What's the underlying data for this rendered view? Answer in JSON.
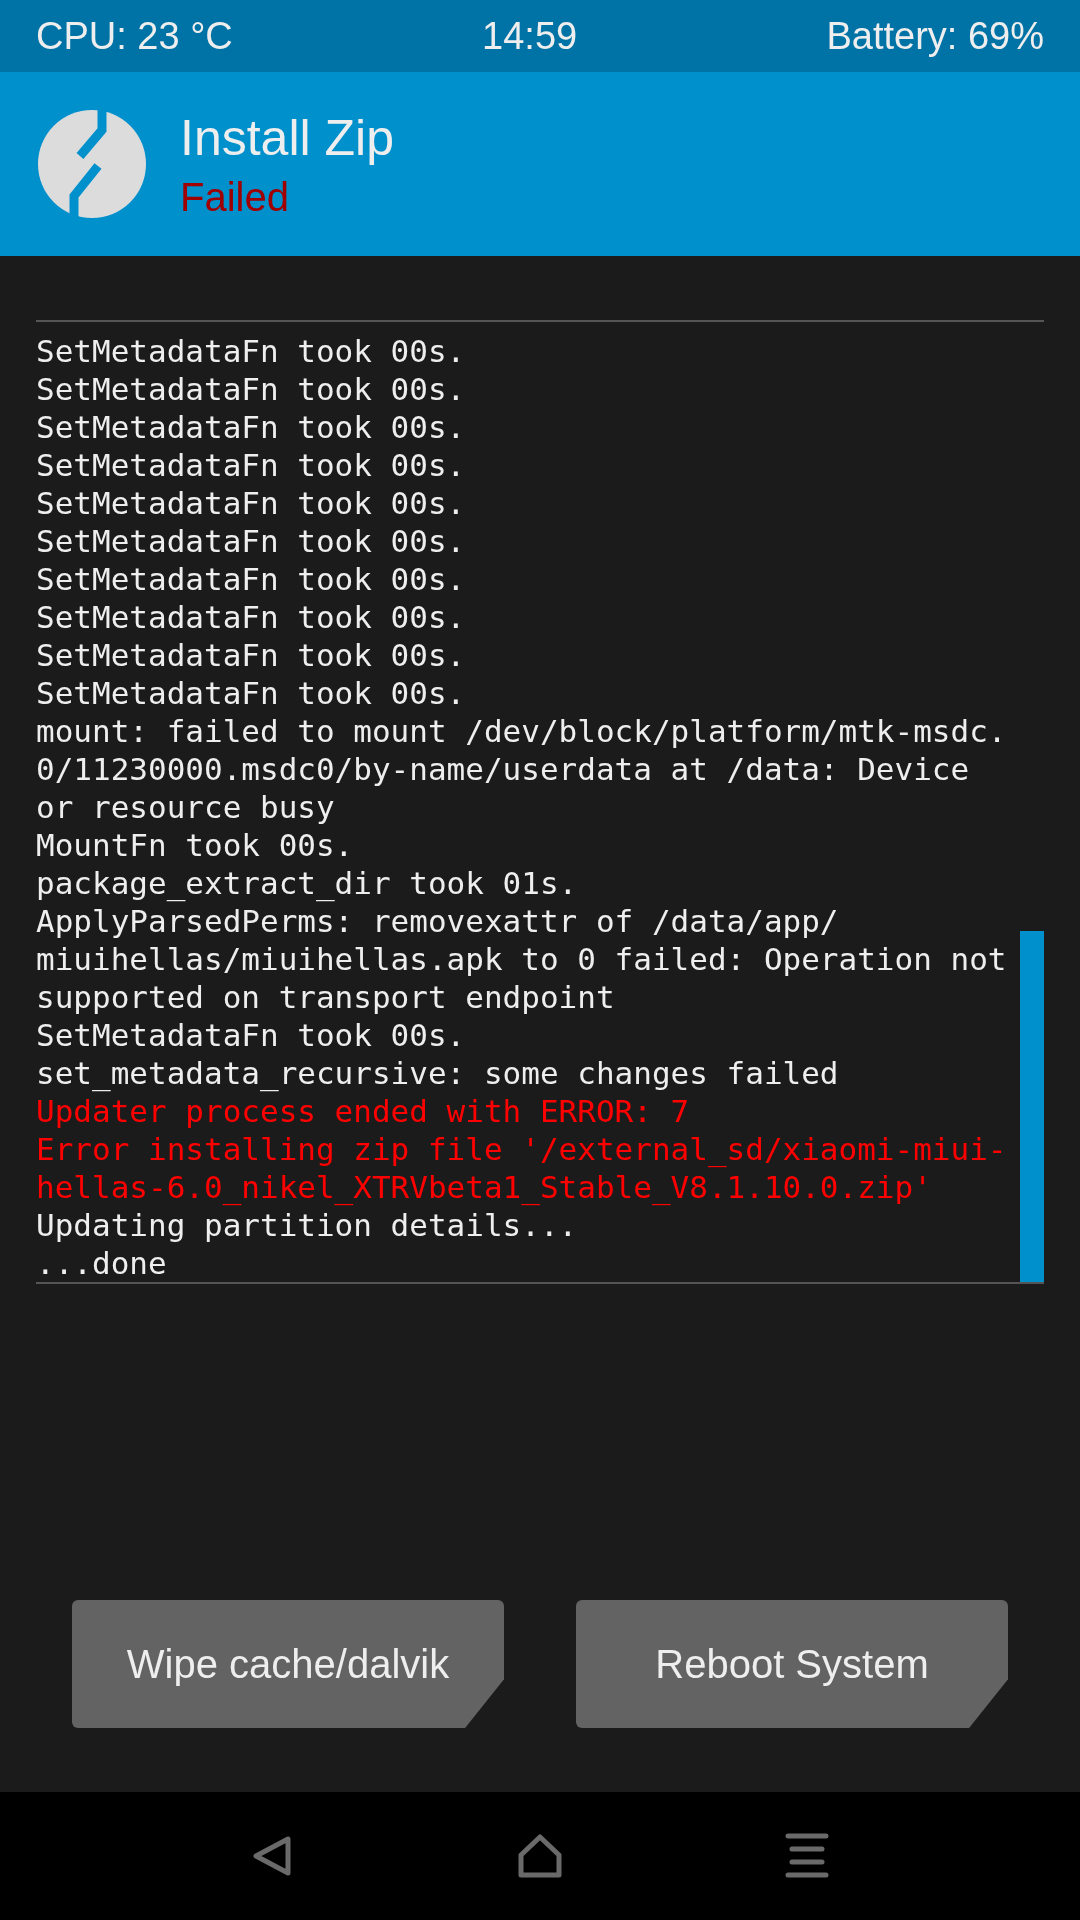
{
  "status_bar": {
    "cpu": "CPU: 23 °C",
    "time": "14:59",
    "battery": "Battery: 69%"
  },
  "header": {
    "title": "Install Zip",
    "status": "Failed"
  },
  "log": {
    "lines": [
      {
        "text": "SetMetadataFn took 00s.",
        "kind": "normal"
      },
      {
        "text": "SetMetadataFn took 00s.",
        "kind": "normal"
      },
      {
        "text": "SetMetadataFn took 00s.",
        "kind": "normal"
      },
      {
        "text": "SetMetadataFn took 00s.",
        "kind": "normal"
      },
      {
        "text": "SetMetadataFn took 00s.",
        "kind": "normal"
      },
      {
        "text": "SetMetadataFn took 00s.",
        "kind": "normal"
      },
      {
        "text": "SetMetadataFn took 00s.",
        "kind": "normal"
      },
      {
        "text": "SetMetadataFn took 00s.",
        "kind": "normal"
      },
      {
        "text": "SetMetadataFn took 00s.",
        "kind": "normal"
      },
      {
        "text": "SetMetadataFn took 00s.",
        "kind": "normal"
      },
      {
        "text": "mount: failed to mount /dev/block/platform/mtk-msdc.",
        "kind": "normal"
      },
      {
        "text": "0/11230000.msdc0/by-name/userdata at /data: Device",
        "kind": "normal"
      },
      {
        "text": "or resource busy",
        "kind": "normal"
      },
      {
        "text": "MountFn took 00s.",
        "kind": "normal"
      },
      {
        "text": "package_extract_dir took 01s.",
        "kind": "normal"
      },
      {
        "text": "ApplyParsedPerms: removexattr of /data/app/",
        "kind": "normal"
      },
      {
        "text": "miuihellas/miuihellas.apk to 0 failed: Operation not",
        "kind": "normal"
      },
      {
        "text": "supported on transport endpoint",
        "kind": "normal"
      },
      {
        "text": "SetMetadataFn took 00s.",
        "kind": "normal"
      },
      {
        "text": "set_metadata_recursive: some changes failed",
        "kind": "normal"
      },
      {
        "text": "Updater process ended with ERROR: 7",
        "kind": "error"
      },
      {
        "text": "Error installing zip file '/external_sd/xiaomi-miui-",
        "kind": "error"
      },
      {
        "text": "hellas-6.0_nikel_XTRVbeta1_Stable_V8.1.10.0.zip'",
        "kind": "error"
      },
      {
        "text": "Updating partition details...",
        "kind": "normal"
      },
      {
        "text": "...done",
        "kind": "normal"
      }
    ]
  },
  "buttons": [
    {
      "label": "Wipe cache/dalvik"
    },
    {
      "label": "Reboot System"
    }
  ]
}
